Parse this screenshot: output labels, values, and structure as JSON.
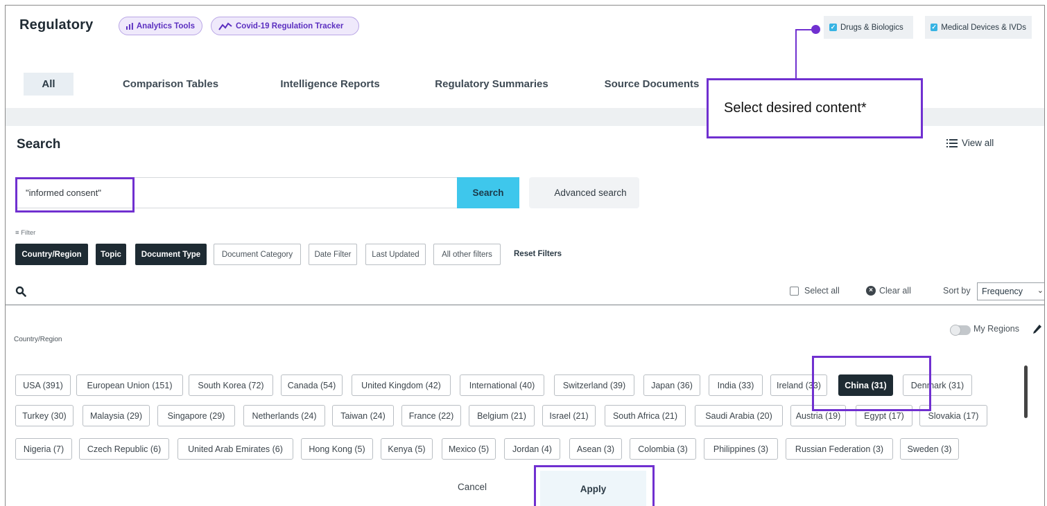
{
  "header": {
    "brand": "Regulatory",
    "pills": [
      {
        "label": "Analytics Tools",
        "icon": "bar-chart-icon"
      },
      {
        "label": "Covid-19 Regulation Tracker",
        "icon": "trend-line-icon"
      }
    ],
    "content_toggles": [
      {
        "label": "Drugs & Biologics",
        "checked": true
      },
      {
        "label": "Medical Devices & IVDs",
        "checked": true
      }
    ]
  },
  "tabs": [
    {
      "label": "All",
      "active": true
    },
    {
      "label": "Comparison Tables"
    },
    {
      "label": "Intelligence Reports"
    },
    {
      "label": "Regulatory Summaries"
    },
    {
      "label": "Source Documents"
    }
  ],
  "search": {
    "title": "Search",
    "view_all": "View all",
    "query": "\"informed consent\"",
    "search_button": "Search",
    "advanced_search": "Advanced search"
  },
  "filters": {
    "label": "Filter",
    "buttons": [
      {
        "label": "Country/Region",
        "active": true
      },
      {
        "label": "Topic",
        "active": true
      },
      {
        "label": "Document Type",
        "active": true
      },
      {
        "label": "Document Category",
        "active": false
      },
      {
        "label": "Date Filter",
        "active": false
      },
      {
        "label": "Last Updated",
        "active": false
      },
      {
        "label": "All other filters",
        "active": false
      }
    ],
    "reset": "Reset Filters"
  },
  "region_panel": {
    "select_all": "Select all",
    "clear_all": "Clear all",
    "sort_by": "Sort by",
    "sort_value": "Frequency",
    "section_label": "Country/Region",
    "my_regions": "My Regions",
    "rows": [
      [
        "USA (391)",
        "European Union (151)",
        "South Korea (72)",
        "Canada (54)",
        "United Kingdom (42)",
        "International (40)",
        "Switzerland (39)",
        "Japan (36)",
        "India (33)",
        "Ireland (33)",
        "China (31)",
        "Denmark (31)"
      ],
      [
        "Turkey (30)",
        "Malaysia (29)",
        "Singapore (29)",
        "Netherlands (24)",
        "Taiwan (24)",
        "France (22)",
        "Belgium (21)",
        "Israel (21)",
        "South Africa (21)",
        "Saudi Arabia (20)",
        "Austria (19)",
        "Egypt (17)",
        "Slovakia (17)"
      ],
      [
        "Nigeria (7)",
        "Czech Republic (6)",
        "United Arab Emirates (6)",
        "Hong Kong (5)",
        "Kenya (5)",
        "Mexico (5)",
        "Jordan (4)",
        "Asean (3)",
        "Colombia (3)",
        "Philippines (3)",
        "Russian Federation (3)",
        "Sweden (3)"
      ]
    ],
    "selected": "China (31)",
    "cancel": "Cancel",
    "apply": "Apply"
  },
  "annotation": {
    "callout": "Select desired content*",
    "color": "#7030d0"
  },
  "colors": {
    "accent_cyan": "#3ec7ec",
    "dark_chip": "#1e2b33",
    "purple_pill": "#5b2fc0"
  }
}
